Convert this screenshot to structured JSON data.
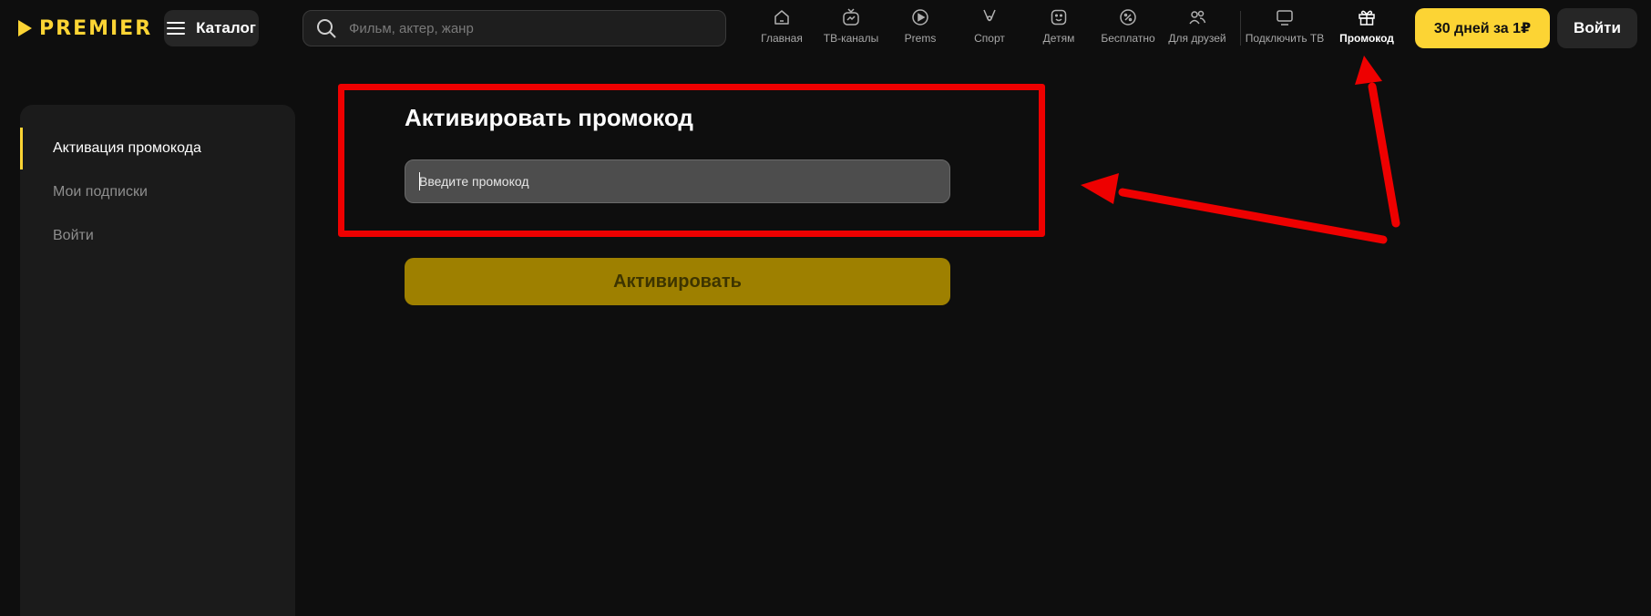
{
  "header": {
    "logo_text": "PREMIER",
    "catalog_label": "Каталог",
    "search_placeholder": "Фильм, актер, жанр",
    "nav": [
      {
        "label": "Главная",
        "icon": "home-icon"
      },
      {
        "label": "ТВ-каналы",
        "icon": "tv-channels-icon"
      },
      {
        "label": "Prems",
        "icon": "play-circle-icon"
      },
      {
        "label": "Спорт",
        "icon": "sport-icon"
      },
      {
        "label": "Детям",
        "icon": "kids-icon"
      },
      {
        "label": "Бесплатно",
        "icon": "percent-icon"
      },
      {
        "label": "Для друзей",
        "icon": "friends-icon"
      }
    ],
    "nav2": [
      {
        "label": "Подключить ТВ",
        "icon": "tv-icon"
      },
      {
        "label": "Промокод",
        "icon": "gift-icon",
        "active": true
      }
    ],
    "trial_label": "30 дней за 1₽",
    "login_label": "Войти"
  },
  "sidebar": {
    "items": [
      {
        "label": "Активация промокода",
        "active": true
      },
      {
        "label": "Мои подписки",
        "active": false
      },
      {
        "label": "Войти",
        "active": false
      }
    ]
  },
  "main": {
    "title": "Активировать промокод",
    "input_placeholder": "Введите промокод",
    "input_value": "",
    "activate_label": "Активировать"
  },
  "colors": {
    "accent": "#fcd434",
    "background": "#0e0e0e",
    "annotation": "#ee0000"
  }
}
